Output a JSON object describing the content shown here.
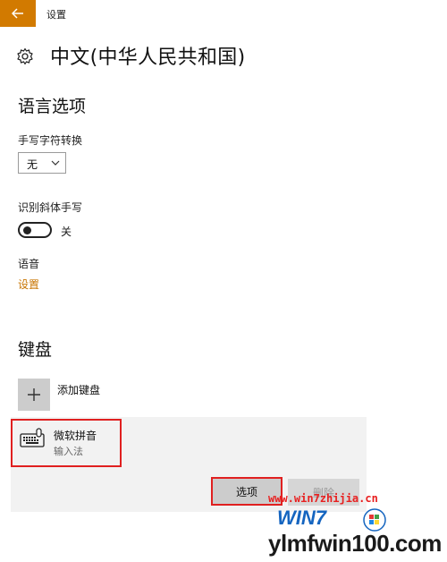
{
  "window": {
    "title": "设置"
  },
  "page": {
    "title": "中文(中华人民共和国)"
  },
  "language_options": {
    "heading": "语言选项",
    "handwriting_conversion": {
      "label": "手写字符转换",
      "selected_value": "无"
    },
    "italic_recognition": {
      "label": "识别斜体手写",
      "toggle_state_text": "关",
      "enabled": false
    },
    "speech": {
      "label": "语音",
      "link": "设置"
    }
  },
  "keyboard": {
    "heading": "键盘",
    "add_label": "添加键盘",
    "items": [
      {
        "name": "微软拼音",
        "subtitle": "输入法"
      }
    ],
    "options_button": "选项",
    "delete_button": "删除"
  },
  "watermark": {
    "url": "www.win7zhijia.cn",
    "logo_text": "WIN7",
    "site": "ylmfwin100.com"
  },
  "colors": {
    "accent": "#d27a00",
    "highlight_border": "#e02020"
  },
  "icons": {
    "back": "back-arrow-icon",
    "settings": "gear-icon",
    "dropdown": "chevron-down-icon",
    "add": "plus-icon",
    "keyboard": "keyboard-icon"
  }
}
